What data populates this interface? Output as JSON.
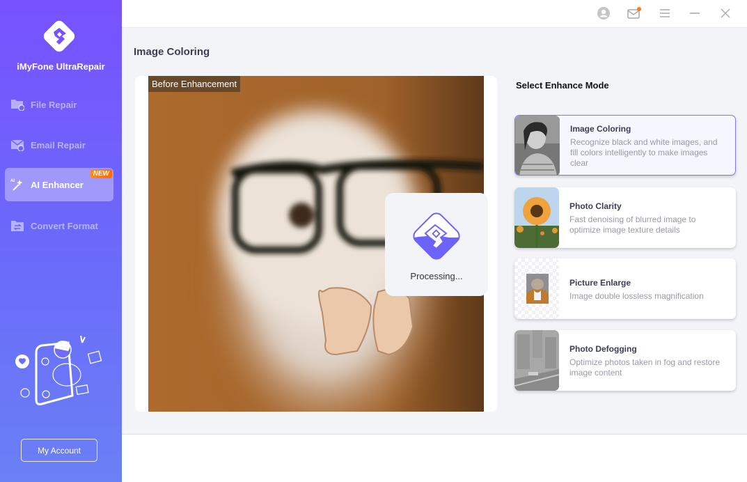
{
  "app": {
    "name": "iMyFone UltraRepair"
  },
  "sidebar": {
    "items": [
      {
        "label": "File Repair",
        "icon": "file-repair-icon",
        "active": false
      },
      {
        "label": "Email Repair",
        "icon": "email-repair-icon",
        "active": false
      },
      {
        "label": "AI Enhancer",
        "icon": "ai-magic-wand-icon",
        "active": true,
        "badge": "NEW"
      },
      {
        "label": "Convert Format",
        "icon": "convert-format-icon",
        "active": false
      }
    ],
    "account_button": "My Account"
  },
  "topbar": {
    "icons": [
      "user-icon",
      "mail-icon",
      "menu-icon",
      "minimize-icon",
      "close-icon"
    ],
    "mail_has_notification": true
  },
  "main": {
    "title": "Image Coloring",
    "preview": {
      "label": "Before Enhancement",
      "processing_text": "Processing..."
    },
    "modes_title": "Select Enhance Mode",
    "modes": [
      {
        "name": "Image Coloring",
        "desc": "Recognize black and white images, and fill colors intelligently to make images clear",
        "selected": true
      },
      {
        "name": "Photo Clarity",
        "desc": "Fast denoising of blurred image to optimize image texture details",
        "selected": false
      },
      {
        "name": "Picture Enlarge",
        "desc": "Image double lossless magnification",
        "selected": false
      },
      {
        "name": "Photo Defogging",
        "desc": "Optimize photos taken in fog and restore image content",
        "selected": false
      }
    ]
  },
  "colors": {
    "accent": "#7752fe",
    "badge": "#ff7a12",
    "selected_border": "#7b78f0"
  }
}
